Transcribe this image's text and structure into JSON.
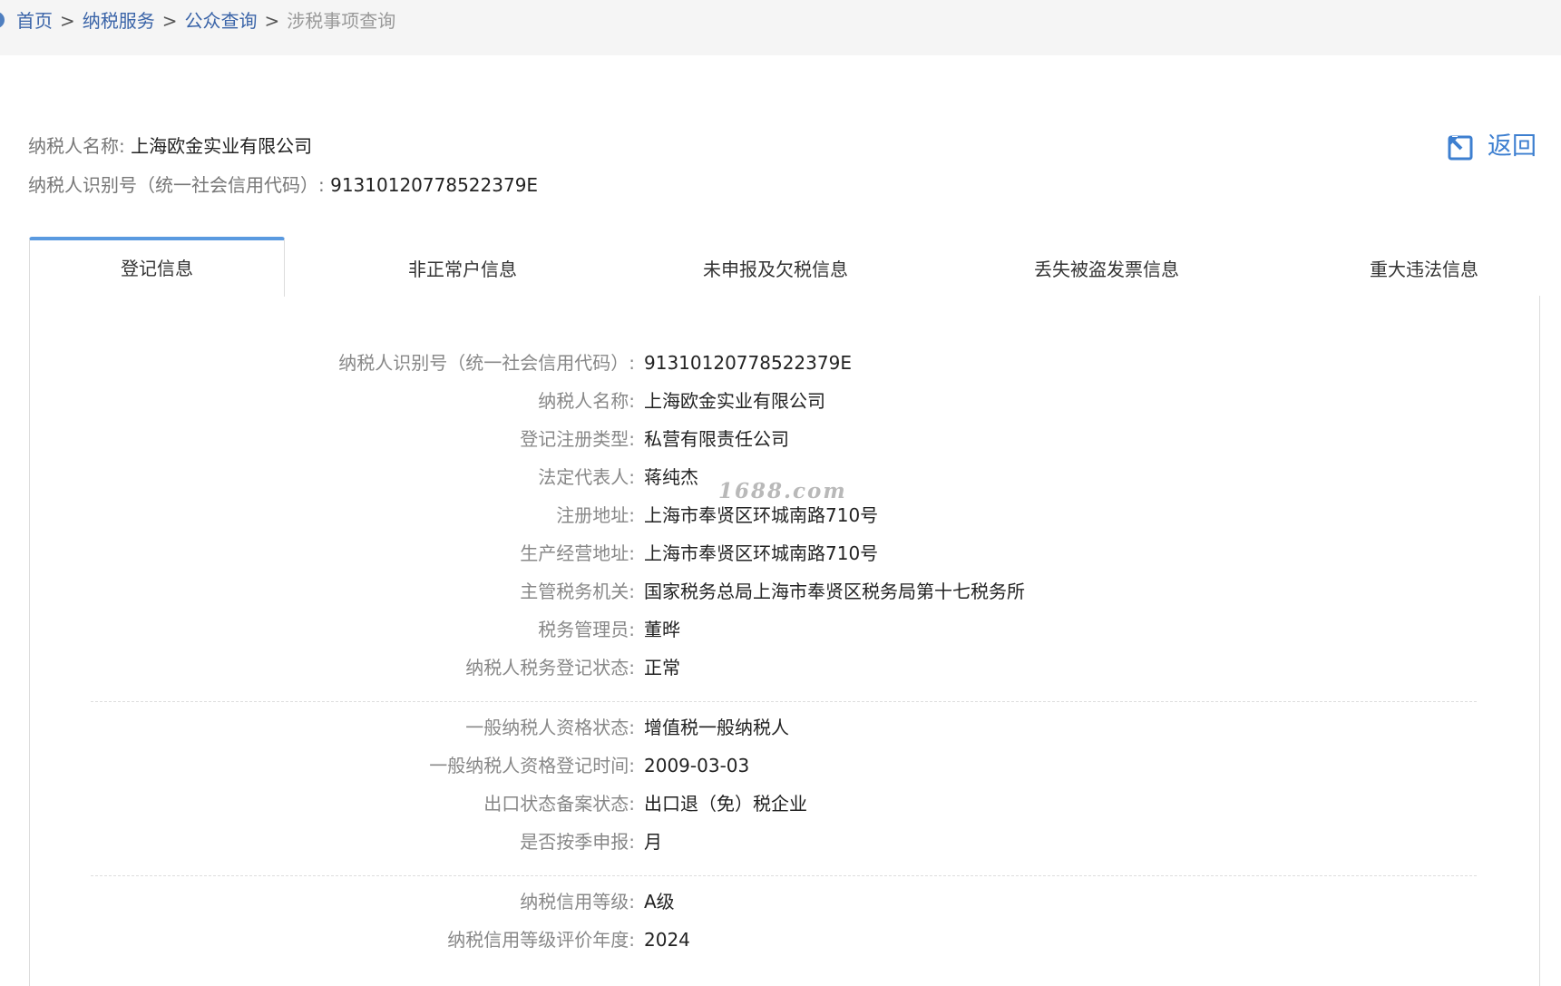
{
  "breadcrumb": {
    "items": [
      "首页",
      "纳税服务",
      "公众查询"
    ],
    "current": "涉税事项查询",
    "separator": ">"
  },
  "header": {
    "name_label": "纳税人名称:",
    "name_value": "上海欧金实业有限公司",
    "id_label": "纳税人识别号（统一社会信用代码）:",
    "id_value": "91310120778522379E",
    "back_label": "返回",
    "back_icon": "back-arrow-icon"
  },
  "tabs": [
    {
      "label": "登记信息",
      "active": true
    },
    {
      "label": "非正常户信息",
      "active": false
    },
    {
      "label": "未申报及欠税信息",
      "active": false
    },
    {
      "label": "丢失被盗发票信息",
      "active": false
    },
    {
      "label": "重大违法信息",
      "active": false
    }
  ],
  "registration": {
    "group1": [
      {
        "label": "纳税人识别号（统一社会信用代码）:",
        "value": "91310120778522379E"
      },
      {
        "label": "纳税人名称:",
        "value": "上海欧金实业有限公司"
      },
      {
        "label": "登记注册类型:",
        "value": "私营有限责任公司"
      },
      {
        "label": "法定代表人:",
        "value": "蒋纯杰"
      },
      {
        "label": "注册地址:",
        "value": "上海市奉贤区环城南路710号"
      },
      {
        "label": "生产经营地址:",
        "value": "上海市奉贤区环城南路710号"
      },
      {
        "label": "主管税务机关:",
        "value": "国家税务总局上海市奉贤区税务局第十七税务所"
      },
      {
        "label": "税务管理员:",
        "value": "董晔"
      },
      {
        "label": "纳税人税务登记状态:",
        "value": "正常"
      }
    ],
    "group2": [
      {
        "label": "一般纳税人资格状态:",
        "value": "增值税一般纳税人"
      },
      {
        "label": "一般纳税人资格登记时间:",
        "value": "2009-03-03"
      },
      {
        "label": "出口状态备案状态:",
        "value": "出口退（免）税企业"
      },
      {
        "label": "是否按季申报:",
        "value": "月"
      }
    ],
    "group3": [
      {
        "label": "纳税信用等级:",
        "value": "A级"
      },
      {
        "label": "纳税信用等级评价年度:",
        "value": "2024"
      }
    ]
  },
  "watermark": "1688.com",
  "colors": {
    "link": "#3a64a8",
    "accent": "#5a9ae0",
    "back": "#3d7fd0"
  }
}
